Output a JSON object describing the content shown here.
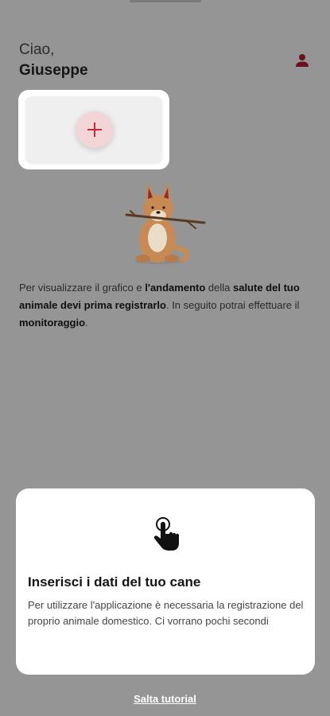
{
  "greeting": {
    "hello": "Ciao,",
    "name": "Giuseppe"
  },
  "icons": {
    "profile": "person-icon",
    "add": "plus-icon",
    "tap": "tap-hand-icon",
    "dog": "dog-with-stick-illustration"
  },
  "info": {
    "p1": "Per visualizzare il grafico e ",
    "b1": "l'andamento",
    "p2": " della ",
    "b2": "salute del tuo animale devi prima registrarlo",
    "p3": ". In seguito potrai effettuare il ",
    "b3": "monitoraggio",
    "p4": "."
  },
  "tutorial": {
    "title": "Inserisci i dati del tuo cane",
    "description": "Per utilizzare l'applicazione è necessaria la registrazione del proprio animale domestico. Ci vorrano pochi secondi"
  },
  "skip_label": "Salta tutorial",
  "colors": {
    "overlay_bg": "#959595",
    "accent": "#c8283a",
    "add_button_bg": "#f3d5d8",
    "profile_icon": "#6b1020",
    "card_bg": "#ffffff"
  }
}
